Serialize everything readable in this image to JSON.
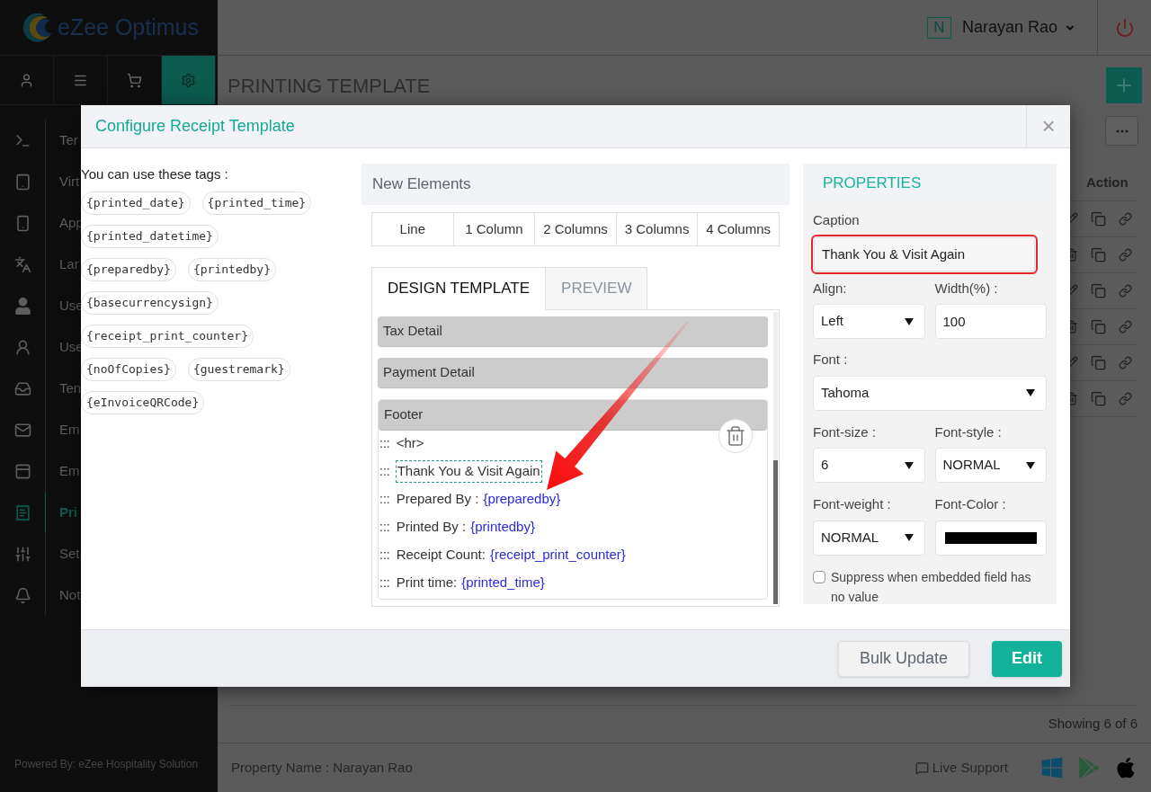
{
  "sidebar": {
    "logo": "eZee Optimus",
    "tabs": [
      {
        "selected": false
      },
      {
        "selected": false
      },
      {
        "selected": false
      },
      {
        "selected": true
      }
    ],
    "menu": [
      {
        "label": "Ter",
        "selected": false
      },
      {
        "label": "Virt",
        "selected": false
      },
      {
        "label": "App",
        "selected": false
      },
      {
        "label": "Lar",
        "selected": false
      },
      {
        "label": "Use",
        "selected": false
      },
      {
        "label": "Use",
        "selected": false
      },
      {
        "label": "Ten",
        "selected": false
      },
      {
        "label": "Em",
        "selected": false
      },
      {
        "label": "Em",
        "selected": false
      },
      {
        "label": "Pri",
        "selected": true
      },
      {
        "label": "Set",
        "selected": false
      },
      {
        "label": "Not",
        "selected": false
      }
    ],
    "powered_by": "Powered By: eZee Hospitality Solution"
  },
  "header": {
    "user_initial": "N",
    "user_name": "Narayan Rao"
  },
  "page": {
    "title": "PRINTING TEMPLATE",
    "action_column": "Action",
    "rows": [
      {
        "kind": "edit"
      },
      {
        "kind": "delete"
      },
      {
        "kind": "edit"
      },
      {
        "kind": "delete"
      },
      {
        "kind": "edit"
      },
      {
        "kind": "delete"
      }
    ],
    "showing": "Showing 6 of 6"
  },
  "footer": {
    "property": "Property Name : Narayan Rao",
    "support": "Live Support"
  },
  "modal": {
    "title": "Configure Receipt Template",
    "close": "×",
    "tags_label": "You can use these tags :",
    "tag_rows": [
      [
        "{printed_date}",
        "{printed_time}"
      ],
      [
        "{printed_datetime}"
      ],
      [
        "{preparedby}",
        "{printedby}"
      ],
      [
        "{basecurrencysign}"
      ],
      [
        "{receipt_print_counter}"
      ],
      [
        "{noOfCopies}",
        "{guestremark}"
      ],
      [
        "{eInvoiceQRCode}"
      ]
    ],
    "new_elements": {
      "title": "New Elements",
      "items": [
        "Line",
        "1 Column",
        "2 Columns",
        "3 Columns",
        "4 Columns"
      ]
    },
    "tabs": [
      {
        "label": "DESIGN TEMPLATE",
        "selected": true
      },
      {
        "label": "PREVIEW",
        "selected": false
      }
    ],
    "sections": [
      {
        "title": "Tax Detail",
        "expanded": false
      },
      {
        "title": "Payment Detail",
        "expanded": false
      },
      {
        "title": "Footer",
        "expanded": true,
        "children": [
          {
            "handle": ":::",
            "text": "<hr>",
            "selected": false
          },
          {
            "handle": ":::",
            "text": "Thank You & Visit Again",
            "selected": true
          },
          {
            "handle": ":::",
            "text": "Prepared By :",
            "tag": "{preparedby}",
            "selected": false
          },
          {
            "handle": ":::",
            "text": "Printed By :",
            "tag": "{printedby}",
            "selected": false
          },
          {
            "handle": ":::",
            "text": "Receipt Count:",
            "tag": "{receipt_print_counter}",
            "selected": false
          },
          {
            "handle": ":::",
            "text": "Print time:",
            "tag": "{printed_time}",
            "selected": false
          }
        ]
      }
    ],
    "properties": {
      "title": "PROPERTIES",
      "caption": {
        "label": "Caption",
        "value": "Thank You & Visit Again"
      },
      "align": {
        "label": "Align:",
        "value": "Left"
      },
      "width": {
        "label": "Width(%) :",
        "value": "100"
      },
      "font": {
        "label": "Font :",
        "value": "Tahoma"
      },
      "font_size": {
        "label": "Font-size :",
        "value": "6"
      },
      "font_style": {
        "label": "Font-style :",
        "value": "NORMAL"
      },
      "font_weight": {
        "label": "Font-weight :",
        "value": "NORMAL"
      },
      "font_color": {
        "label": "Font-Color :",
        "color": "#000000"
      },
      "suppress": {
        "label": "Suppress when embedded field has no value",
        "checked": false
      }
    },
    "buttons": [
      {
        "label": "Bulk Update",
        "kind": "secondary"
      },
      {
        "label": "Edit",
        "kind": "primary"
      }
    ]
  }
}
